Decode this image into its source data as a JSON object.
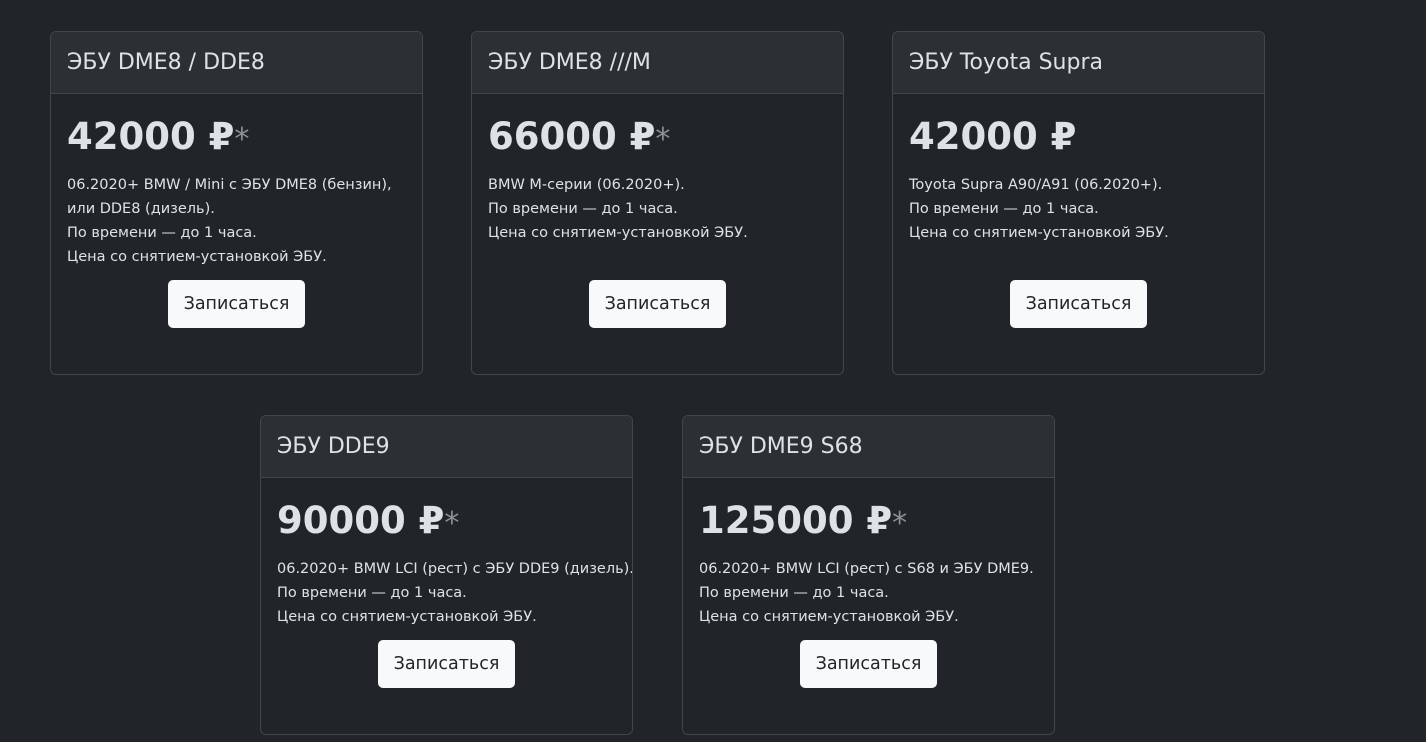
{
  "cards": [
    {
      "title": "ЭБУ DME8 / DDE8",
      "price": "42000 ₽",
      "star": "*",
      "lines": [
        "06.2020+ BMW / Mini с ЭБУ DME8 (бензин),",
        "или DDE8 (дизель).",
        "По времени — до 1 часа.",
        "Цена со снятием-установкой ЭБУ."
      ],
      "button": "Записаться"
    },
    {
      "title": "ЭБУ DME8 ///M",
      "price": "66000 ₽",
      "star": "*",
      "lines": [
        "BMW M-серии (06.2020+).",
        "По времени — до 1 часа.",
        "Цена со снятием-установкой ЭБУ."
      ],
      "button": "Записаться"
    },
    {
      "title": "ЭБУ Toyota Supra",
      "price": "42000 ₽",
      "star": "",
      "lines": [
        "Toyota Supra A90/A91 (06.2020+).",
        "По времени — до 1 часа.",
        "Цена со снятием-установкой ЭБУ."
      ],
      "button": "Записаться"
    },
    {
      "title": "ЭБУ DDE9",
      "price": "90000 ₽",
      "star": "*",
      "lines": [
        "06.2020+ BMW LCI (рест) с ЭБУ DDE9 (дизель).",
        "По времени — до 1 часа.",
        "Цена со снятием-установкой ЭБУ."
      ],
      "button": "Записаться"
    },
    {
      "title": "ЭБУ DME9 S68",
      "price": "125000 ₽",
      "star": "*",
      "lines": [
        "06.2020+ BMW LCI (рест) с S68 и ЭБУ DME9.",
        "По времени — до 1 часа.",
        "Цена со снятием-установкой ЭБУ."
      ],
      "button": "Записаться"
    }
  ]
}
